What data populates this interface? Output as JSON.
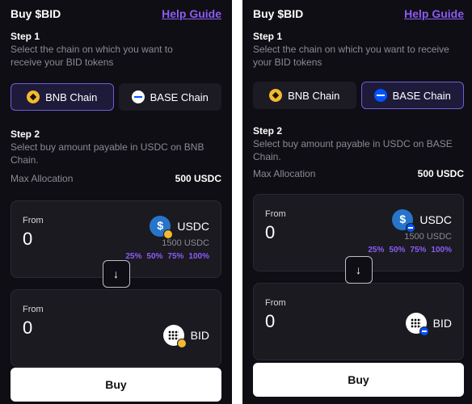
{
  "panels": [
    {
      "title": "Buy $BID",
      "help_label": "Help Guide",
      "step1": {
        "label": "Step 1",
        "description": "Select the chain on which you  want to receive your BID tokens"
      },
      "chains": [
        {
          "label": "BNB Chain",
          "icon": "bnb-chain-icon",
          "selected": true
        },
        {
          "label": "BASE Chain",
          "icon": "base-chain-icon",
          "selected": false
        }
      ],
      "step2": {
        "label": "Step 2",
        "description": "Select buy amount payable in USDC on BNB Chain."
      },
      "max_allocation": {
        "label": "Max Allocation",
        "value": "500 USDC"
      },
      "from": {
        "label": "From",
        "amount": "0",
        "token": "USDC",
        "balance": "1500 USDC",
        "percents": [
          "25%",
          "50%",
          "75%",
          "100%"
        ]
      },
      "swap_icon": "↓",
      "to": {
        "label": "From",
        "amount": "0",
        "token": "BID"
      },
      "buy_label": "Buy"
    },
    {
      "title": "Buy $BID",
      "help_label": "Help Guide",
      "step1": {
        "label": "Step 1",
        "description": "Select the chain on which you  want to receive your BID tokens"
      },
      "chains": [
        {
          "label": "BNB Chain",
          "icon": "bnb-chain-icon",
          "selected": false
        },
        {
          "label": "BASE Chain",
          "icon": "base-chain-icon",
          "selected": true
        }
      ],
      "step2": {
        "label": "Step 2",
        "description": "Select buy amount payable in USDC on BASE Chain."
      },
      "max_allocation": {
        "label": "Max Allocation",
        "value": "500 USDC"
      },
      "from": {
        "label": "From",
        "amount": "0",
        "token": "USDC",
        "balance": "1500 USDC",
        "percents": [
          "25%",
          "50%",
          "75%",
          "100%"
        ]
      },
      "swap_icon": "↓",
      "to": {
        "label": "From",
        "amount": "0",
        "token": "BID"
      },
      "buy_label": "Buy"
    }
  ],
  "colors": {
    "background": "#0f0e14",
    "card": "#1b1a21",
    "accent": "#8b5cf6",
    "selected_border": "#6d5fd6",
    "bnb": "#f3ba2f",
    "base": "#0052ff",
    "usdc": "#2775ca"
  }
}
